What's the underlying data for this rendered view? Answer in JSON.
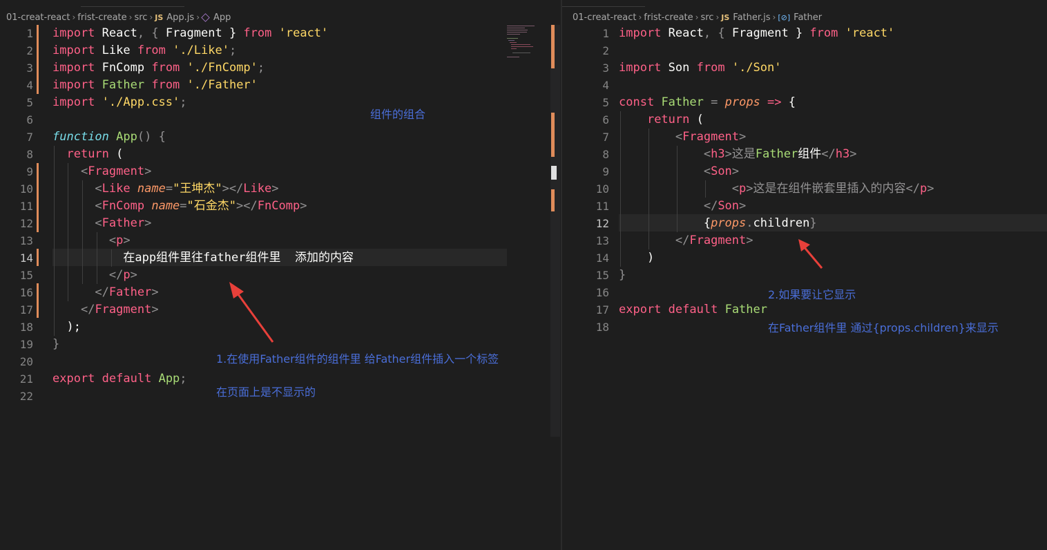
{
  "left": {
    "breadcrumb": [
      "01-creat-react",
      "frist-create",
      "src",
      "App.js",
      "App"
    ],
    "js_badge": "JS",
    "active_line": 14,
    "lines": [
      {
        "n": "1",
        "t": "import React, { Fragment } from 'react'"
      },
      {
        "n": "2",
        "t": "import Like from './Like';"
      },
      {
        "n": "3",
        "t": "import FnComp from './FnComp';"
      },
      {
        "n": "4",
        "t": "import Father from './Father'"
      },
      {
        "n": "5",
        "t": "import './App.css';"
      },
      {
        "n": "6",
        "t": ""
      },
      {
        "n": "7",
        "t": "function App() {"
      },
      {
        "n": "8",
        "t": "  return ("
      },
      {
        "n": "9",
        "t": "    <Fragment>"
      },
      {
        "n": "10",
        "t": "      <Like name=\"王坤杰\"></Like>"
      },
      {
        "n": "11",
        "t": "      <FnComp name=\"石金杰\"></FnComp>"
      },
      {
        "n": "12",
        "t": "      <Father>"
      },
      {
        "n": "13",
        "t": "        <p>"
      },
      {
        "n": "14",
        "t": "          在app组件里往father组件里  添加的内容"
      },
      {
        "n": "15",
        "t": "        </p>"
      },
      {
        "n": "16",
        "t": "      </Father>"
      },
      {
        "n": "17",
        "t": "    </Fragment>"
      },
      {
        "n": "18",
        "t": "  );"
      },
      {
        "n": "19",
        "t": "}"
      },
      {
        "n": "20",
        "t": ""
      },
      {
        "n": "21",
        "t": "export default App;"
      },
      {
        "n": "22",
        "t": ""
      }
    ],
    "annotations": {
      "heading": "组件的组合",
      "note1": "1.在使用Father组件的组件里  给Father组件插入一个标签",
      "note2": "在页面上是不显示的"
    }
  },
  "right": {
    "breadcrumb": [
      "01-creat-react",
      "frist-create",
      "src",
      "Father.js",
      "Father"
    ],
    "js_badge": "JS",
    "active_line": 12,
    "lines": [
      {
        "n": "1",
        "t": "import React, { Fragment } from 'react'"
      },
      {
        "n": "2",
        "t": ""
      },
      {
        "n": "3",
        "t": "import Son from './Son'"
      },
      {
        "n": "4",
        "t": ""
      },
      {
        "n": "5",
        "t": "const Father = props => {"
      },
      {
        "n": "6",
        "t": "    return ("
      },
      {
        "n": "7",
        "t": "        <Fragment>"
      },
      {
        "n": "8",
        "t": "            <h3>这是Father组件</h3>"
      },
      {
        "n": "9",
        "t": "            <Son>"
      },
      {
        "n": "10",
        "t": "                <p>这是在组件嵌套里插入的内容</p>"
      },
      {
        "n": "11",
        "t": "            </Son>"
      },
      {
        "n": "12",
        "t": "            {props.children}"
      },
      {
        "n": "13",
        "t": "        </Fragment>"
      },
      {
        "n": "14",
        "t": "    )"
      },
      {
        "n": "15",
        "t": "}"
      },
      {
        "n": "16",
        "t": ""
      },
      {
        "n": "17",
        "t": "export default Father"
      },
      {
        "n": "18",
        "t": ""
      }
    ],
    "annotations": {
      "note1": "2.如果要让它显示",
      "note2": "在Father组件里  通过{props.children}来显示"
    }
  },
  "colors": {
    "background": "#1e1e1e",
    "keyword": "#ff6188",
    "string": "#ffd866",
    "function": "#a9dc76",
    "modified_bar": "#e08c5a",
    "annotation": "#4a6ed8",
    "arrow": "#e8403a"
  }
}
